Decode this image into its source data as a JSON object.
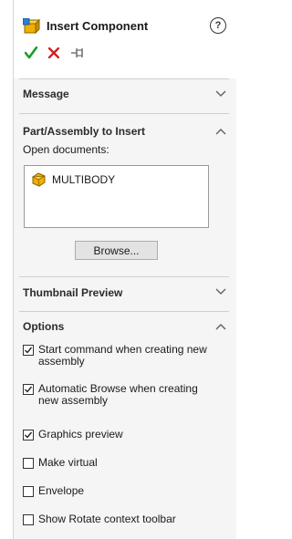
{
  "header": {
    "title": "Insert Component",
    "help_icon_text": "?"
  },
  "sections": {
    "message": {
      "title": "Message"
    },
    "part_assembly": {
      "title": "Part/Assembly to Insert",
      "open_documents_label": "Open documents:",
      "documents": [
        "MULTIBODY"
      ],
      "browse_label": "Browse..."
    },
    "thumbnail": {
      "title": "Thumbnail Preview"
    },
    "options": {
      "title": "Options",
      "items": [
        {
          "label": "Start command when creating new assembly",
          "checked": true
        },
        {
          "label": "Automatic Browse when creating new assembly",
          "checked": true
        },
        {
          "label": "Graphics preview",
          "checked": true
        },
        {
          "label": "Make virtual",
          "checked": false
        },
        {
          "label": "Envelope",
          "checked": false
        },
        {
          "label": "Show Rotate context toolbar",
          "checked": false
        }
      ]
    }
  },
  "colors": {
    "ok": "#1f9d2b",
    "cancel": "#d32020",
    "part_icon": "#f0b000"
  }
}
